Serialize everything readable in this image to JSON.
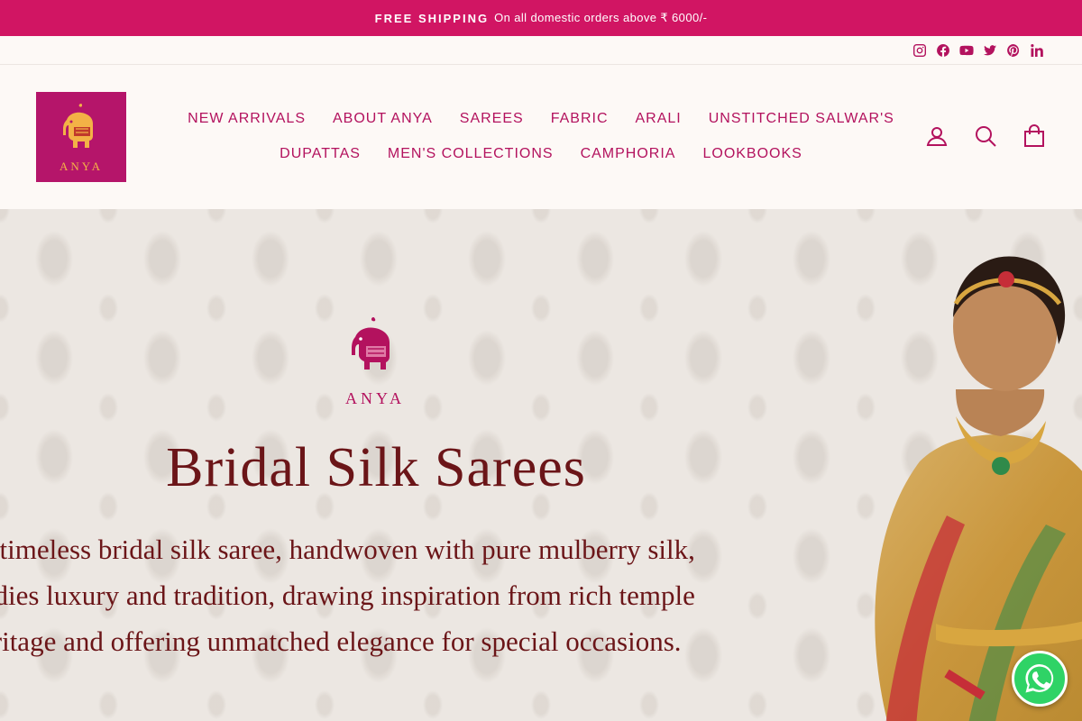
{
  "announcement": {
    "strong": "FREE SHIPPING",
    "rest": "On all domestic orders above ₹ 6000/-"
  },
  "social": [
    {
      "icon": "instagram-icon"
    },
    {
      "icon": "facebook-icon"
    },
    {
      "icon": "youtube-icon"
    },
    {
      "icon": "twitter-icon"
    },
    {
      "icon": "pinterest-icon"
    },
    {
      "icon": "linkedin-icon"
    }
  ],
  "logo": {
    "text": "ANYA"
  },
  "nav": {
    "row1": [
      "NEW ARRIVALS",
      "ABOUT ANYA",
      "SAREES",
      "FABRIC",
      "ARALI",
      "UNSTITCHED SALWAR'S"
    ],
    "row2": [
      "DUPATTAS",
      "MEN'S COLLECTIONS",
      "CAMPHORIA",
      "LOOKBOOKS"
    ]
  },
  "header_icons": [
    "user-icon",
    "search-icon",
    "cart-icon"
  ],
  "hero": {
    "logo_text": "ANYA",
    "title": "Bridal Silk Sarees",
    "lines": [
      "e timeless bridal silk saree, handwoven with pure mulberry silk,",
      "odies luxury and tradition, drawing inspiration from rich temple",
      "eritage and offering unmatched elegance for special occasions."
    ]
  },
  "colors": {
    "brand": "#d11563",
    "text": "#b3125e",
    "hero_text": "#6b1518",
    "whatsapp": "#2fd366"
  }
}
